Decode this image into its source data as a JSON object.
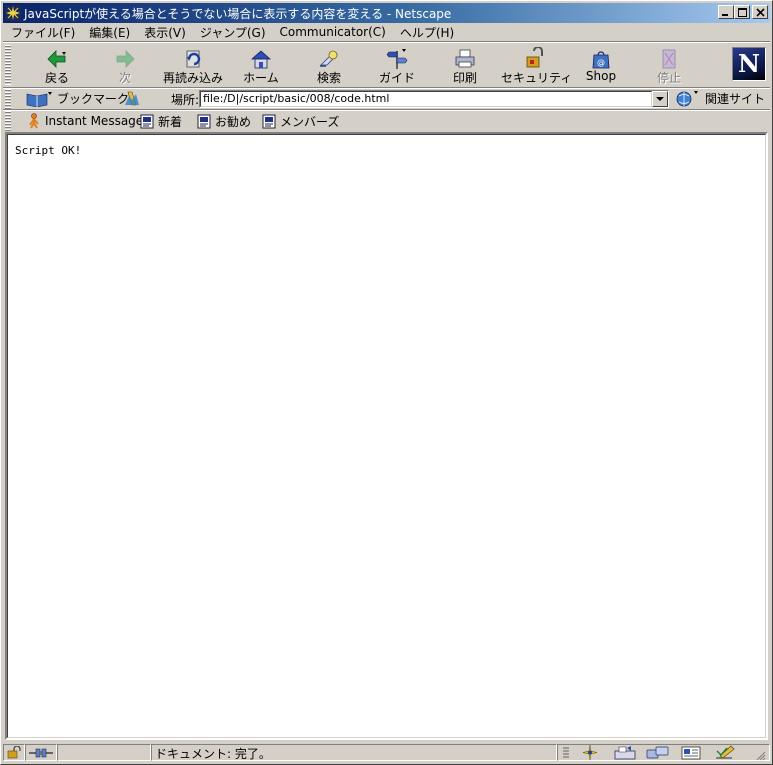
{
  "window": {
    "title": "JavaScriptが使える場合とそうでない場合に表示する内容を変える - Netscape"
  },
  "menu": [
    {
      "label": "ファイル(F)"
    },
    {
      "label": "編集(E)"
    },
    {
      "label": "表示(V)"
    },
    {
      "label": "ジャンプ(G)"
    },
    {
      "label": "Communicator(C)"
    },
    {
      "label": "ヘルプ(H)"
    }
  ],
  "toolbar": {
    "buttons": [
      {
        "label": "戻る",
        "icon": "back-arrow-icon",
        "enabled": true
      },
      {
        "label": "次",
        "icon": "forward-arrow-icon",
        "enabled": false
      },
      {
        "label": "再読み込み",
        "icon": "reload-icon",
        "enabled": true
      },
      {
        "label": "ホーム",
        "icon": "home-icon",
        "enabled": true
      },
      {
        "label": "検索",
        "icon": "search-icon",
        "enabled": true
      },
      {
        "label": "ガイド",
        "icon": "guide-icon",
        "enabled": true
      },
      {
        "label": "印刷",
        "icon": "print-icon",
        "enabled": true
      },
      {
        "label": "セキュリティ",
        "icon": "security-lock-icon",
        "enabled": true
      },
      {
        "label": "Shop",
        "icon": "shop-bag-icon",
        "enabled": true
      },
      {
        "label": "停止",
        "icon": "stop-icon",
        "enabled": false
      }
    ],
    "logo": "N"
  },
  "location": {
    "bookmarks_label": "ブックマーク",
    "location_label": "場所:",
    "url": "file:/D|/script/basic/008/code.html",
    "related_label": "関連サイト"
  },
  "personal": {
    "items": [
      {
        "label": "Instant Message",
        "icon": "instant-message-icon"
      },
      {
        "label": "新着",
        "icon": "bookmark-page-icon"
      },
      {
        "label": "お勧め",
        "icon": "bookmark-page-icon"
      },
      {
        "label": "メンバーズ",
        "icon": "bookmark-page-icon"
      }
    ]
  },
  "content": {
    "text": "Script OK!"
  },
  "status": {
    "text": "ドキュメント: 完了。"
  }
}
